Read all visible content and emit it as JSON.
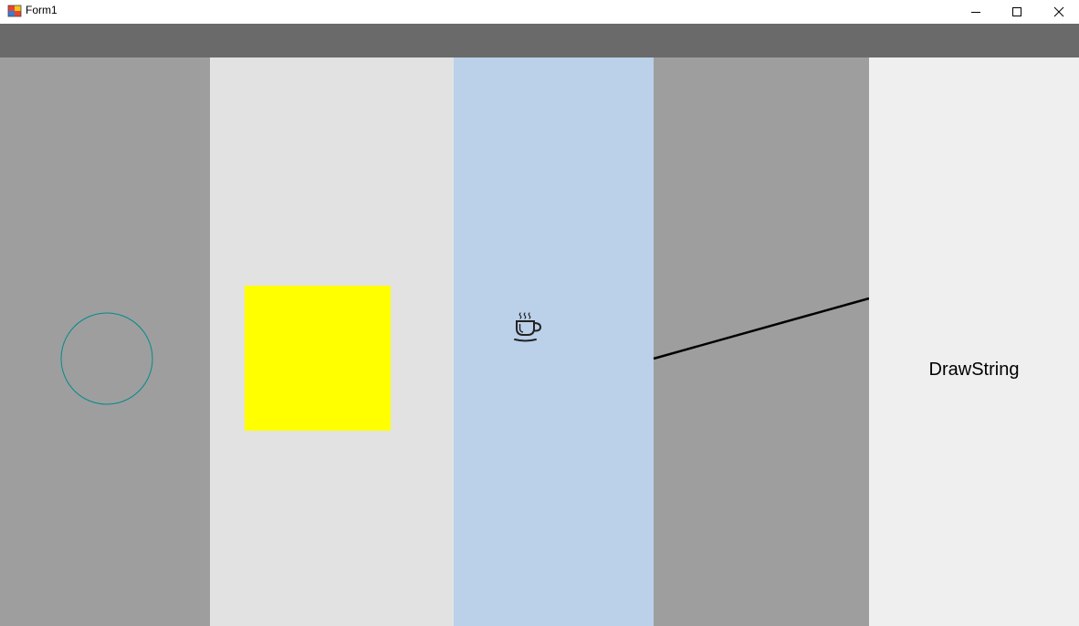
{
  "window": {
    "title": "Form1",
    "controls": {
      "minimize_icon": "minimize-icon",
      "maximize_icon": "maximize-icon",
      "close_icon": "close-icon"
    }
  },
  "panels": [
    {
      "id": "panel-1",
      "color": "#9e9e9e",
      "content": "circle-outline",
      "stroke": "#008b8b"
    },
    {
      "id": "panel-2",
      "color": "#e2e2e2",
      "content": "filled-rectangle",
      "fill": "#ffff00"
    },
    {
      "id": "panel-3",
      "color": "#bbd0e9",
      "content": "coffee-cup-icon"
    },
    {
      "id": "panel-4",
      "color": "#9e9e9e",
      "content": "line",
      "stroke": "#000000"
    },
    {
      "id": "panel-5",
      "color": "#efefef",
      "content": "text"
    }
  ],
  "drawstring": {
    "text": "DrawString"
  },
  "colors": {
    "toolbar": "#6a6a6a",
    "titlebar": "#ffffff"
  }
}
